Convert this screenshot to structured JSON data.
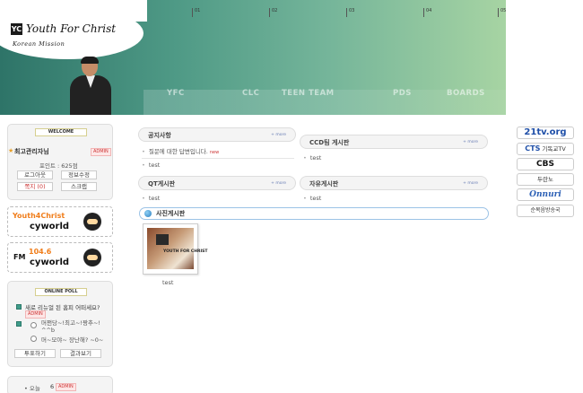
{
  "header": {
    "logo_mark": "YC",
    "logo_text": "Youth For Christ",
    "logo_sub": "Korean Mission",
    "timeline": [
      "01",
      "02",
      "03",
      "04",
      "05"
    ],
    "nav": [
      "YFC",
      "CLC",
      "TEEN TEAM",
      "PDS",
      "BOARDS"
    ]
  },
  "welcome": {
    "title": "WELCOME",
    "user": "최고관리자님",
    "admin_badge": "ADMIN",
    "points": "포인트 : 625점",
    "logout": "로그아웃",
    "edit_profile": "정보수정",
    "memo": "쪽지 (0)",
    "scrap": "스크랩"
  },
  "cyworld": {
    "banner1_title": "Youth4Christ",
    "banner1_brand": "cyworld",
    "banner2_fm": "FM",
    "banner2_freq": "104.6",
    "banner2_brand": "cyworld"
  },
  "poll": {
    "title": "ONLINE POLL",
    "question": "새로 리뉴얼 된 홈피 어떠세요?",
    "admin_badge": "ADMIN",
    "option1": "머쩐당~!최고~!짱추~! ^^b",
    "option2": "머~모야~ 장난해? ~0~",
    "vote": "투표하기",
    "result": "결과보기"
  },
  "bottom": {
    "label": "• 오늘",
    "count": "6",
    "admin_badge": "ADMIN"
  },
  "boards": {
    "more": "+ more",
    "notice": {
      "title": "공지사항",
      "items": [
        "질문에 대한 답변입니다.",
        "test"
      ],
      "new_tag": "new"
    },
    "ccd": {
      "title": "CCD팀 게시판",
      "items": [
        "test"
      ]
    },
    "qt": {
      "title": "QT게시판",
      "items": [
        "test"
      ]
    },
    "free": {
      "title": "자유게시판",
      "items": [
        "test"
      ]
    },
    "photo": {
      "title": "사진게시판",
      "caption": "test",
      "thumb_text": "YOUTH FOR CHRIST"
    }
  },
  "right_links": {
    "link1": "21tv.org",
    "link2_brand": "CTS",
    "link2_text": "기독교TV",
    "link3": "CBS",
    "link4": "두란노",
    "link5": "Onnuri",
    "link6": "순복음방송국"
  }
}
